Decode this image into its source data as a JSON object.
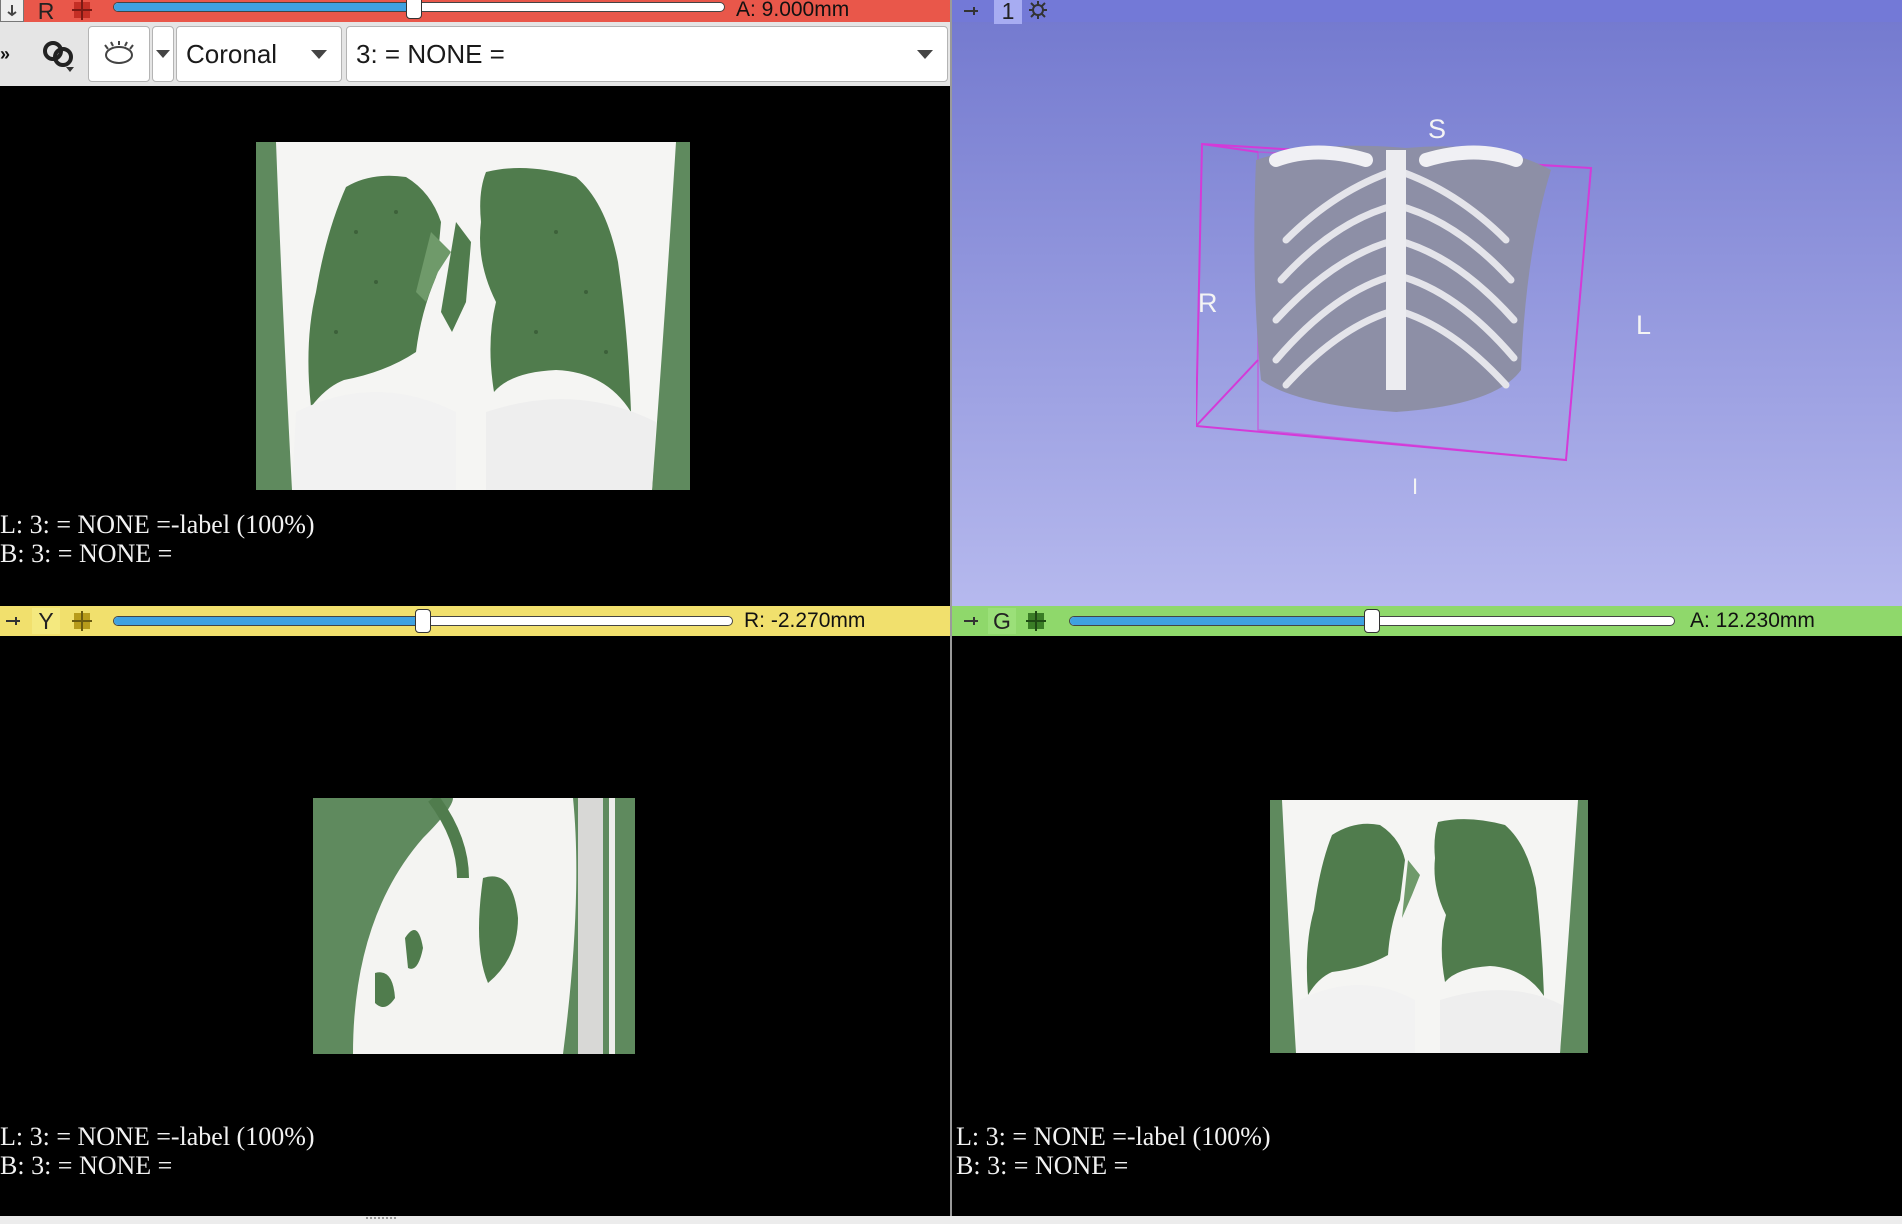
{
  "red_view": {
    "letter": "R",
    "offset": "A: 9.000mm",
    "slider_fraction": 0.5,
    "color": "#e9574a",
    "controls": {
      "orientation_value": "Coronal",
      "label_volume_value": "3: = NONE ="
    },
    "annotations": [
      "L: 3: = NONE =-label (100%)",
      "B: 3: = NONE ="
    ]
  },
  "view_3d": {
    "label": "1",
    "color": "#a3a8ef",
    "orientation_markers": {
      "superior": "S",
      "right": "R",
      "left": "L",
      "inferior": "I"
    }
  },
  "yellow_view": {
    "letter": "Y",
    "offset": "R: -2.270mm",
    "slider_fraction": 0.5,
    "color": "#f1e06d",
    "annotations": [
      "L: 3: = NONE =-label (100%)",
      "B: 3: = NONE ="
    ]
  },
  "green_view": {
    "letter": "G",
    "offset": "A: 12.230mm",
    "slider_fraction": 0.5,
    "color": "#8fd86b",
    "annotations": [
      "L: 3: = NONE =-label (100%)",
      "B: 3: = NONE ="
    ]
  },
  "icons": [
    "pin-icon",
    "slice-layout-icon",
    "more-chevrons-icon",
    "link-icon",
    "eye-icon",
    "gear-icon"
  ]
}
